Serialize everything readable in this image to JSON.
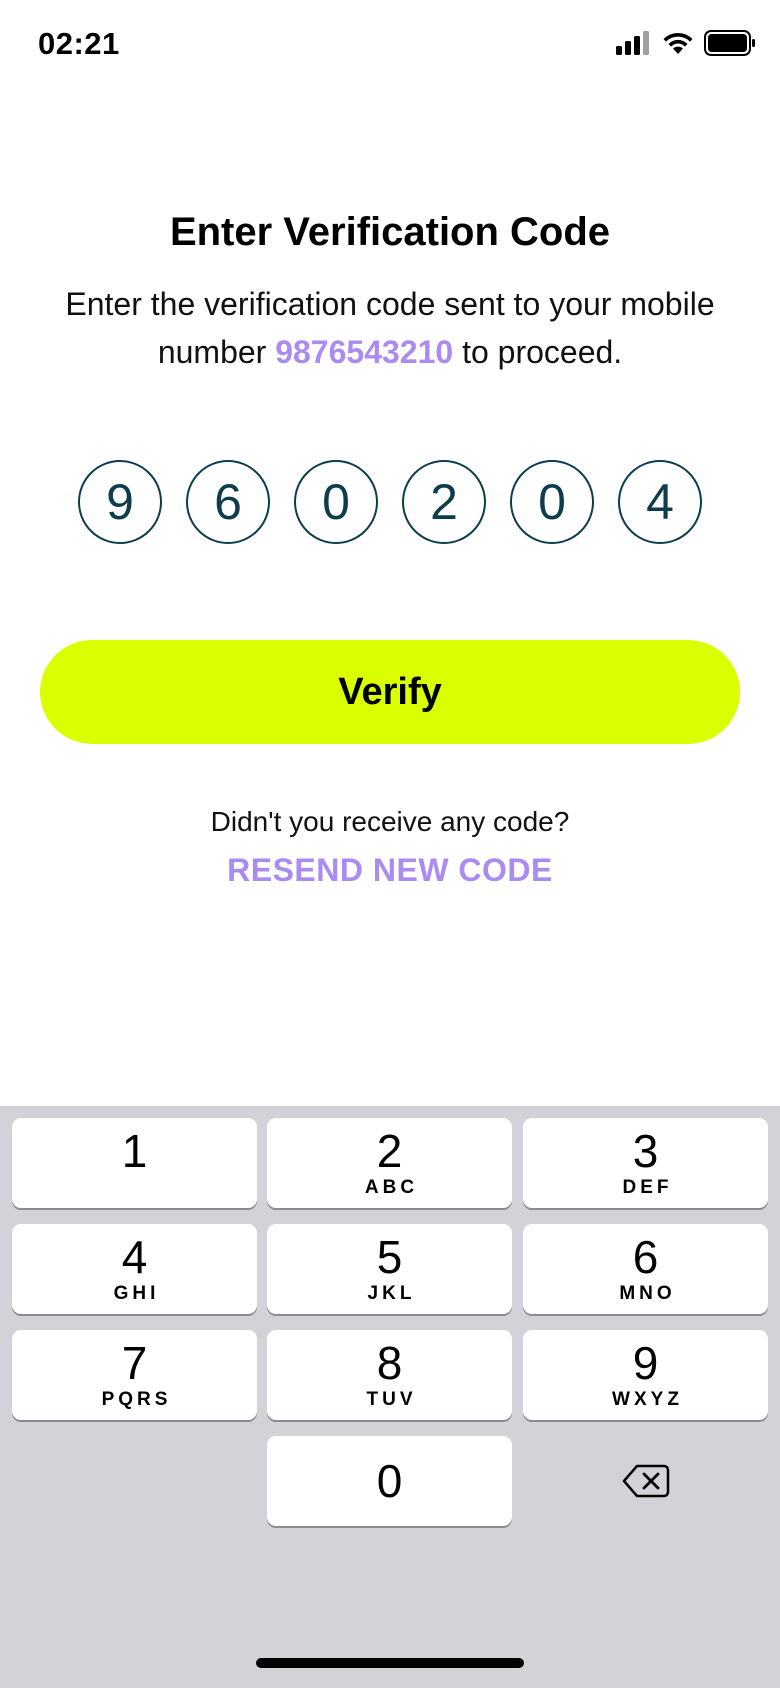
{
  "status_bar": {
    "time": "02:21"
  },
  "header": {
    "title": "Enter Verification Code",
    "subtitle_part1": "Enter the verification code sent to your mobile number ",
    "phone_number": "9876543210",
    "subtitle_part2": " to proceed."
  },
  "code": {
    "digits": [
      "9",
      "6",
      "0",
      "2",
      "0",
      "4"
    ]
  },
  "verify_button": {
    "label": "Verify"
  },
  "resend": {
    "question": "Didn't you receive any code?",
    "link_label": "RESEND NEW CODE"
  },
  "keypad": {
    "keys": [
      {
        "num": "1",
        "letters": ""
      },
      {
        "num": "2",
        "letters": "ABC"
      },
      {
        "num": "3",
        "letters": "DEF"
      },
      {
        "num": "4",
        "letters": "GHI"
      },
      {
        "num": "5",
        "letters": "JKL"
      },
      {
        "num": "6",
        "letters": "MNO"
      },
      {
        "num": "7",
        "letters": "PQRS"
      },
      {
        "num": "8",
        "letters": "TUV"
      },
      {
        "num": "9",
        "letters": "WXYZ"
      },
      {
        "num": "0",
        "letters": ""
      }
    ],
    "delete_icon": "backspace-icon"
  },
  "colors": {
    "accent_purple": "#a98bf2",
    "verify_button_bg": "#d9ff00",
    "digit_color": "#0d3d4c",
    "keypad_bg": "#d1d3d9"
  }
}
